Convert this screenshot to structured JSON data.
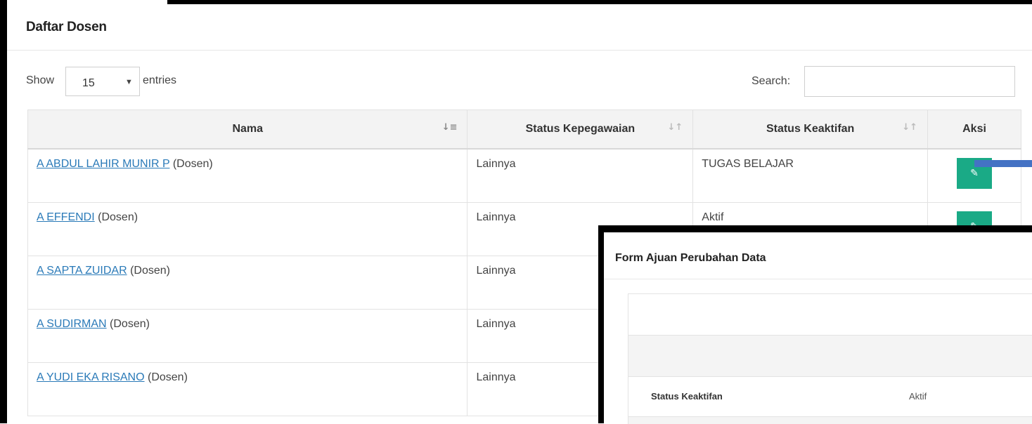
{
  "panel": {
    "title": "Daftar Dosen"
  },
  "controls": {
    "show_label": "Show",
    "entries_value": "15",
    "entries_label": "entries",
    "search_label": "Search:",
    "search_value": ""
  },
  "table": {
    "columns": [
      "Nama",
      "Status Kepegawaian",
      "Status Keaktifan",
      "Aksi"
    ],
    "rows": [
      {
        "name": "A ABDUL LAHIR MUNIR P",
        "role": "(Dosen)",
        "kepegawaian": "Lainnya",
        "keaktifan": "TUGAS BELAJAR"
      },
      {
        "name": "A EFFENDI",
        "role": "(Dosen)",
        "kepegawaian": "Lainnya",
        "keaktifan": "Aktif"
      },
      {
        "name": "A SAPTA ZUIDAR",
        "role": "(Dosen)",
        "kepegawaian": "Lainnya",
        "keaktifan": ""
      },
      {
        "name": "A SUDIRMAN",
        "role": "(Dosen)",
        "kepegawaian": "Lainnya",
        "keaktifan": ""
      },
      {
        "name": "A YUDI EKA RISANO",
        "role": "(Dosen)",
        "kepegawaian": "Lainnya",
        "keaktifan": ""
      }
    ]
  },
  "modal": {
    "title": "Form Ajuan Perubahan Data",
    "field_label": "Status Keaktifan",
    "field_value": "Aktif"
  },
  "colors": {
    "link": "#2a7ab8",
    "edit_button": "#1aaa86",
    "pointer_arrow": "#4472c4"
  }
}
